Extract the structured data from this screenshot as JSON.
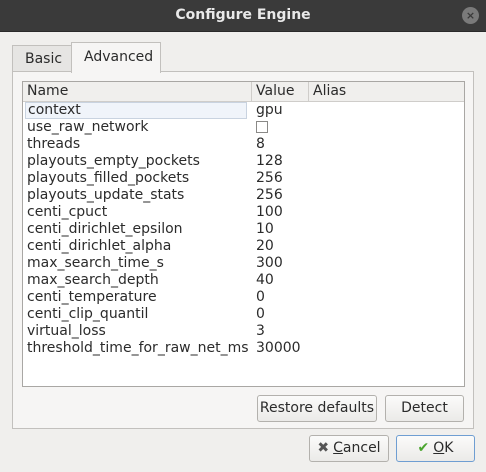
{
  "window": {
    "title": "Configure Engine",
    "close_glyph": "×"
  },
  "tabs": [
    {
      "label": "Basic",
      "active": false
    },
    {
      "label": "Advanced",
      "active": true
    }
  ],
  "table": {
    "columns": [
      "Name",
      "Value",
      "Alias"
    ],
    "rows": [
      {
        "name": "context",
        "value": "gpu"
      },
      {
        "name": "use_raw_network",
        "value": "",
        "type": "checkbox",
        "checked": false
      },
      {
        "name": "threads",
        "value": "8"
      },
      {
        "name": "playouts_empty_pockets",
        "value": "128"
      },
      {
        "name": "playouts_filled_pockets",
        "value": "256"
      },
      {
        "name": "playouts_update_stats",
        "value": "256"
      },
      {
        "name": "centi_cpuct",
        "value": "100"
      },
      {
        "name": "centi_dirichlet_epsilon",
        "value": "10"
      },
      {
        "name": "centi_dirichlet_alpha",
        "value": "20"
      },
      {
        "name": "max_search_time_s",
        "value": "300"
      },
      {
        "name": "max_search_depth",
        "value": "40"
      },
      {
        "name": "centi_temperature",
        "value": "0"
      },
      {
        "name": "centi_clip_quantil",
        "value": "0"
      },
      {
        "name": "virtual_loss",
        "value": "3"
      },
      {
        "name": "threshold_time_for_raw_net_ms",
        "value": "30000"
      }
    ]
  },
  "panel_buttons": {
    "restore": "Restore defaults",
    "detect": "Detect"
  },
  "dialog_buttons": {
    "cancel_prefix": "",
    "cancel_underline": "C",
    "cancel_rest": "ancel",
    "ok_prefix": "",
    "ok_underline": "O",
    "ok_rest": "K"
  },
  "icons": {
    "cancel": "cancel-x-icon",
    "ok": "checkmark-icon",
    "close": "close-icon"
  },
  "colors": {
    "titlebar": "#3a3a3a",
    "ok_check": "#4aa52e",
    "selected_row": "#f0f4fa"
  }
}
